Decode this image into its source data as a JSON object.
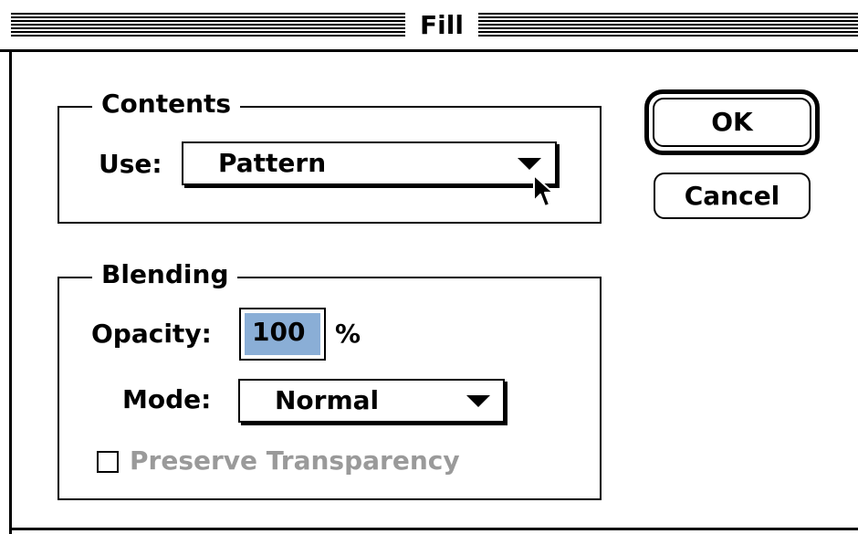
{
  "window": {
    "title": "Fill"
  },
  "contents": {
    "group_label": "Contents",
    "use_label": "Use:",
    "use_value": "Pattern"
  },
  "blending": {
    "group_label": "Blending",
    "opacity_label": "Opacity:",
    "opacity_value": "100",
    "opacity_unit": "%",
    "mode_label": "Mode:",
    "mode_value": "Normal",
    "preserve_transparency_label": "Preserve Transparency",
    "preserve_transparency_checked": false,
    "preserve_transparency_enabled": false
  },
  "buttons": {
    "ok": "OK",
    "cancel": "Cancel"
  },
  "colors": {
    "selection": "#8aaed6",
    "disabled_text": "#9a9a9a"
  }
}
